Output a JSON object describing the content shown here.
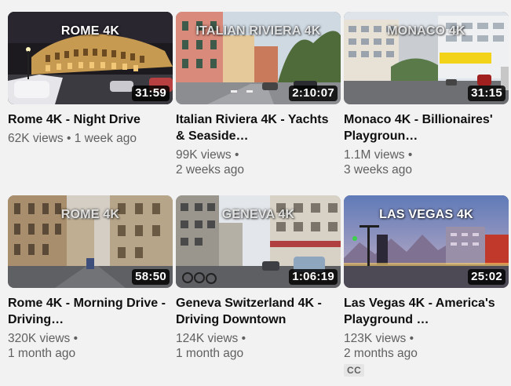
{
  "videos": [
    {
      "overlay": "ROME 4K",
      "duration": "31:59",
      "title": "Rome 4K - Night Drive",
      "views": "62K views",
      "age": "1 week ago",
      "badge": ""
    },
    {
      "overlay": "ITALIAN RIVIERA 4K",
      "duration": "2:10:07",
      "title": "Italian Riviera 4K - Yachts & Seaside…",
      "views": "99K views",
      "age": "2 weeks ago",
      "badge": ""
    },
    {
      "overlay": "MONACO 4K",
      "duration": "31:15",
      "title": "Monaco 4K - Billionaires' Playgroun…",
      "views": "1.1M views",
      "age": "3 weeks ago",
      "badge": ""
    },
    {
      "overlay": "ROME 4K",
      "duration": "58:50",
      "title": "Rome 4K - Morning Drive - Driving…",
      "views": "320K views",
      "age": "1 month ago",
      "badge": ""
    },
    {
      "overlay": "GENEVA 4K",
      "duration": "1:06:19",
      "title": "Geneva Switzerland 4K - Driving Downtown",
      "views": "124K views",
      "age": "1 month ago",
      "badge": ""
    },
    {
      "overlay": "LAS VEGAS 4K",
      "duration": "25:02",
      "title": "Las Vegas 4K - America's Playground …",
      "views": "123K views",
      "age": "2 months ago",
      "badge": "CC"
    }
  ]
}
